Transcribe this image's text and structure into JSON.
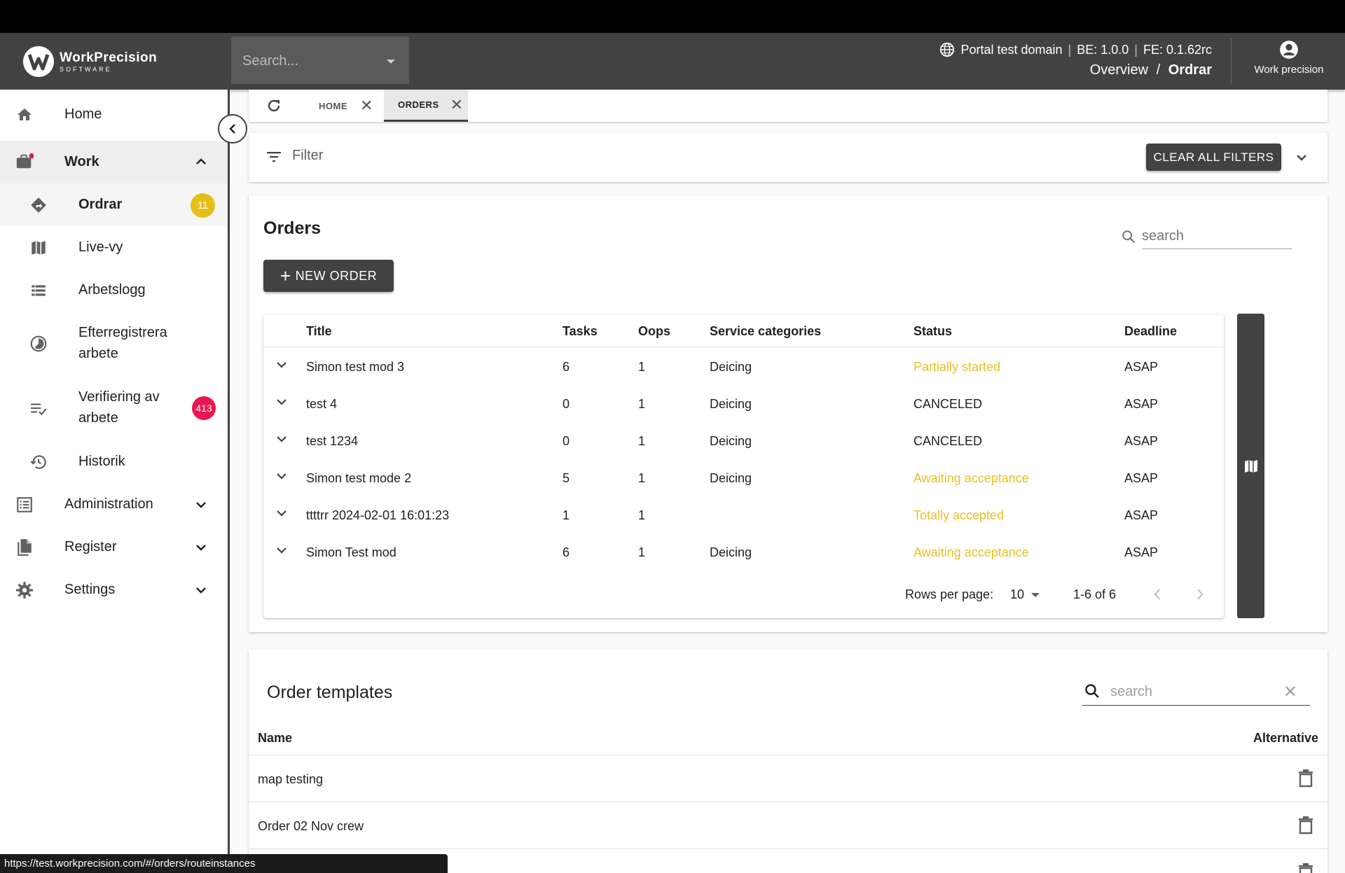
{
  "app": {
    "logo_name": "WorkPrecision",
    "logo_sub": "SOFTWARE",
    "search_placeholder": "Search...",
    "domain": "Portal test domain",
    "be_version": "BE: 1.0.0",
    "fe_version": "FE: 0.1.62rc",
    "breadcrumb_parent": "Overview",
    "breadcrumb_sep": "/",
    "breadcrumb_current": "Ordrar",
    "user_name": "Work precision"
  },
  "sidebar": {
    "items": [
      {
        "label": "Home",
        "icon": "home-icon"
      },
      {
        "label": "Work",
        "icon": "briefcase-icon"
      },
      {
        "label": "Ordrar",
        "icon": "directions-icon",
        "badge": "11"
      },
      {
        "label": "Live-vy",
        "icon": "map-icon"
      },
      {
        "label": "Arbetslogg",
        "icon": "list-icon"
      },
      {
        "label": "Efterregistrera",
        "label2": "arbete",
        "icon": "clock-icon"
      },
      {
        "label": "Verifiering av",
        "label2": "arbete",
        "icon": "checklist-icon",
        "badge": "413"
      },
      {
        "label": "Historik",
        "icon": "history-icon"
      },
      {
        "label": "Administration",
        "icon": "admin-icon"
      },
      {
        "label": "Register",
        "icon": "files-icon"
      },
      {
        "label": "Settings",
        "icon": "gear-icon"
      }
    ]
  },
  "tabs": [
    {
      "label": "HOME"
    },
    {
      "label": "ORDERS"
    }
  ],
  "filter": {
    "label": "Filter",
    "clear_label": "CLEAR ALL FILTERS"
  },
  "orders": {
    "title": "Orders",
    "search_placeholder": "search",
    "new_label": "NEW ORDER",
    "columns": [
      "Title",
      "Tasks",
      "Oops",
      "Service categories",
      "Status",
      "Deadline"
    ],
    "rows": [
      {
        "title": "Simon test mod 3",
        "tasks": "6",
        "oops": "1",
        "service": "Deicing",
        "status": "Partially started",
        "warn": true,
        "deadline": "ASAP"
      },
      {
        "title": "test 4",
        "tasks": "0",
        "oops": "1",
        "service": "Deicing",
        "status": "CANCELED",
        "warn": false,
        "deadline": "ASAP"
      },
      {
        "title": "test 1234",
        "tasks": "0",
        "oops": "1",
        "service": "Deicing",
        "status": "CANCELED",
        "warn": false,
        "deadline": "ASAP"
      },
      {
        "title": "Simon test mode 2",
        "tasks": "5",
        "oops": "1",
        "service": "Deicing",
        "status": "Awaiting acceptance",
        "warn": true,
        "deadline": "ASAP"
      },
      {
        "title": "ttttrr 2024-02-01 16:01:23",
        "tasks": "1",
        "oops": "1",
        "service": "",
        "status": "Totally accepted",
        "warn": true,
        "deadline": "ASAP"
      },
      {
        "title": "Simon Test mod",
        "tasks": "6",
        "oops": "1",
        "service": "Deicing",
        "status": "Awaiting acceptance",
        "warn": true,
        "deadline": "ASAP"
      }
    ],
    "rows_per_page_label": "Rows per page:",
    "rows_per_page": "10",
    "range": "1-6 of 6"
  },
  "templates": {
    "title": "Order templates",
    "search_placeholder": "search",
    "col_name": "Name",
    "col_alt": "Alternative",
    "rows": [
      "map testing",
      "Order 02 Nov crew",
      ""
    ]
  },
  "statusbar": {
    "url": "https://test.workprecision.com/#/orders/routeinstances"
  },
  "colors": {
    "appbar": "#424242",
    "warn": "#e8c026",
    "badge_yellow": "#e6be18",
    "badge_red": "#e8174f"
  }
}
